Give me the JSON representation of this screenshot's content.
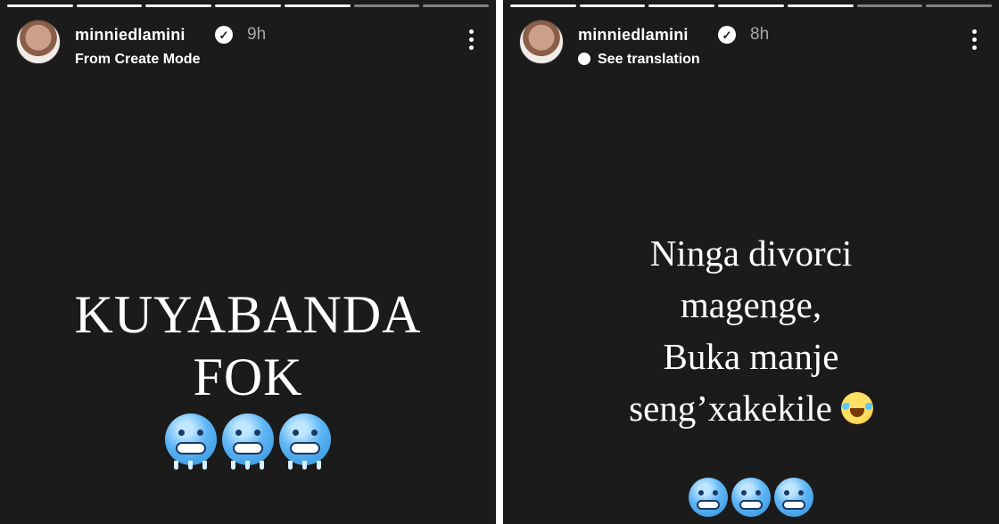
{
  "stories": [
    {
      "username": "minniedlamini",
      "time_ago": "9h",
      "subline": "From Create Mode",
      "caption_lines": [
        "KUYABANDA",
        "FOK"
      ],
      "emoji_icons": [
        "cold-face-icon",
        "cold-face-icon",
        "cold-face-icon"
      ]
    },
    {
      "username": "minniedlamini",
      "time_ago": "8h",
      "subline": "See translation",
      "caption_lines": [
        "Ninga divorci",
        "magenge,",
        "Buka manje",
        "seng’xakekile"
      ],
      "caption_emoji": "rolling-on-floor-laughing-icon",
      "emoji_icons": [
        "cold-face-icon",
        "cold-face-icon",
        "cold-face-icon"
      ]
    }
  ],
  "colors": {
    "story_background": "#1b1b1b",
    "text_primary": "#ffffff",
    "time_gray": "#a8a8a8",
    "divider": "#ffffff"
  }
}
